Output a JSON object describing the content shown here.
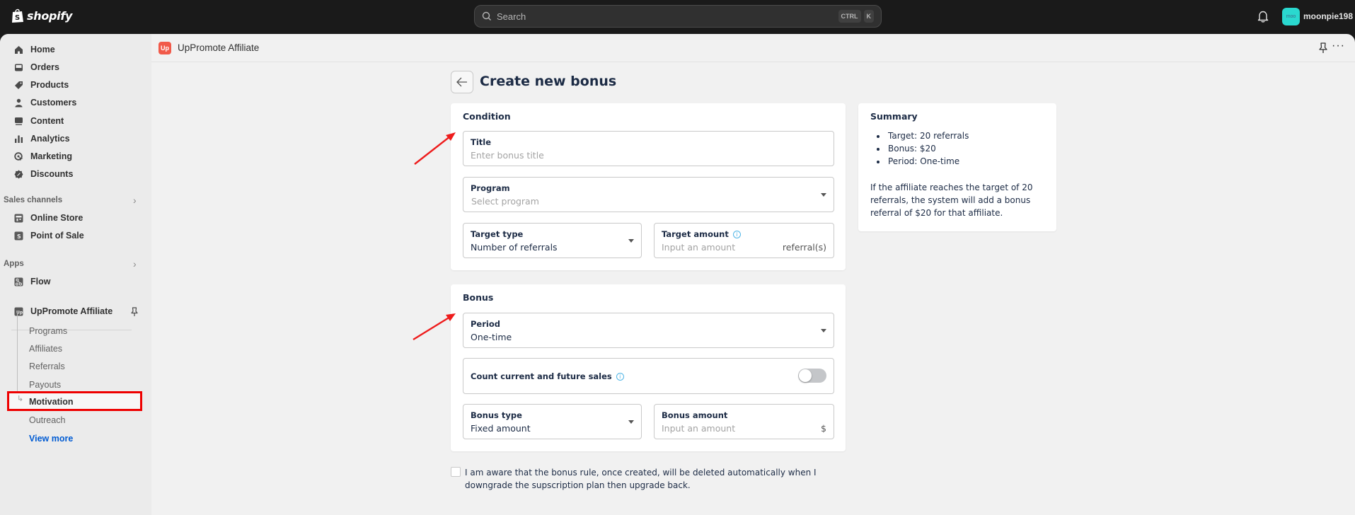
{
  "topbar": {
    "brand": "shopify",
    "search_placeholder": "Search",
    "shortcut_keys": [
      "CTRL",
      "K"
    ],
    "avatar_initials": "moo",
    "username": "moonpie198"
  },
  "sidebar": {
    "main_items": [
      {
        "label": "Home",
        "icon": "home-icon"
      },
      {
        "label": "Orders",
        "icon": "orders-icon"
      },
      {
        "label": "Products",
        "icon": "tag-icon"
      },
      {
        "label": "Customers",
        "icon": "person-icon"
      },
      {
        "label": "Content",
        "icon": "content-icon"
      },
      {
        "label": "Analytics",
        "icon": "bar-chart-icon"
      },
      {
        "label": "Marketing",
        "icon": "target-icon"
      },
      {
        "label": "Discounts",
        "icon": "discount-icon"
      }
    ],
    "sales_channels": {
      "label": "Sales channels",
      "items": [
        {
          "label": "Online Store",
          "icon": "store-icon"
        },
        {
          "label": "Point of Sale",
          "icon": "pos-icon"
        }
      ]
    },
    "apps": {
      "label": "Apps",
      "items": [
        {
          "label": "Flow",
          "icon": "flow-icon"
        }
      ]
    },
    "pinned_app": {
      "label": "UpPromote Affiliate",
      "subitems": [
        "Programs",
        "Affiliates",
        "Referrals",
        "Payouts",
        "Motivation",
        "Outreach"
      ],
      "active": "Motivation"
    },
    "view_more": "View more"
  },
  "appbar": {
    "app_icon_text": "Up",
    "app_title": "UpPromote Affiliate"
  },
  "page": {
    "title": "Create new bonus",
    "condition": {
      "heading": "Condition",
      "title_field": {
        "label": "Title",
        "placeholder": "Enter bonus title"
      },
      "program_field": {
        "label": "Program",
        "placeholder": "Select program"
      },
      "target_type": {
        "label": "Target type",
        "value": "Number of referrals"
      },
      "target_amount": {
        "label": "Target amount",
        "placeholder": "Input an amount",
        "suffix": "referral(s)"
      }
    },
    "bonus": {
      "heading": "Bonus",
      "period": {
        "label": "Period",
        "value": "One-time"
      },
      "count_sales": {
        "label": "Count current and future sales",
        "enabled": false
      },
      "bonus_type": {
        "label": "Bonus type",
        "value": "Fixed amount"
      },
      "bonus_amount": {
        "label": "Bonus amount",
        "placeholder": "Input an amount",
        "suffix": "$"
      }
    },
    "summary": {
      "heading": "Summary",
      "items": [
        "Target: 20 referrals",
        "Bonus: $20",
        "Period: One-time"
      ],
      "description": "If the affiliate reaches the target of 20 referrals, the system will add a bonus referral of $20 for that affiliate."
    },
    "acknowledgement": {
      "checked": false,
      "text": "I am aware that the bonus rule, once created, will be deleted automatically when I downgrade the supscription plan then upgrade back."
    }
  },
  "colors": {
    "annotation": "#ee1c1c",
    "link": "#005bd3",
    "app_brand": "#f15a4a",
    "avatar": "#2ad8cf"
  }
}
